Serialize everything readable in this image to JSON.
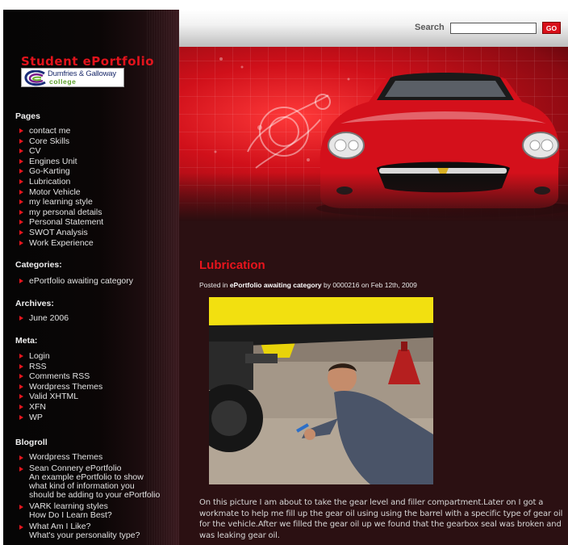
{
  "site": {
    "title": "Student ePortfolio",
    "logo_line1": "Dumfries & Galloway",
    "logo_line2": "college"
  },
  "search": {
    "label": "Search",
    "value": "",
    "go_label": "GO"
  },
  "sidebar": {
    "pages_heading": "Pages",
    "pages": [
      "contact me",
      "Core Skills",
      "CV",
      "Engines Unit",
      "Go-Karting",
      "Lubrication",
      "Motor Vehicle",
      "my learning style",
      "my personal details",
      "Personal Statement",
      "SWOT Analysis",
      "Work Experience"
    ],
    "categories_heading": "Categories:",
    "categories": [
      "ePortfolio awaiting category"
    ],
    "archives_heading": "Archives:",
    "archives": [
      "June 2006"
    ],
    "meta_heading": "Meta:",
    "meta": [
      "Login",
      "RSS",
      "Comments RSS",
      "Wordpress Themes",
      "Valid XHTML",
      "XFN",
      "WP"
    ],
    "blogroll_heading": "Blogroll",
    "blogroll": [
      {
        "label": "Wordpress Themes",
        "desc": []
      },
      {
        "label": "Sean Connery ePortfolio",
        "desc": [
          "An example ePortfolio to show",
          "what kind of information you",
          "should be adding to your ePortfolio"
        ]
      },
      {
        "label": "VARK learning styles",
        "desc": [
          "How Do I Learn Best?"
        ]
      },
      {
        "label": "What Am I Like?",
        "desc": [
          "What's your personality type?"
        ]
      }
    ]
  },
  "post": {
    "title": "Lubrication",
    "meta_prefix": "Posted in",
    "meta_category": "ePortfolio awaiting category",
    "meta_by": "by",
    "meta_author": "0000216",
    "meta_on": "on",
    "meta_date": "Feb 12th, 2009",
    "body": "On this picture I am about to take the gear level and filler compartment.Later on I got a workmate to help me fill up the gear oil using using the barrel with a specific type of gear oil for the vehicle.After we filled the gear oil up we found that the gearbox seal was broken and was leaking gear oil."
  },
  "colors": {
    "accent_red": "#e3131c",
    "sidebar_bg": "#050505",
    "content_bg": "#2b1012"
  },
  "icons": [
    "arrow-bullet-icon",
    "college-logo-icon"
  ]
}
